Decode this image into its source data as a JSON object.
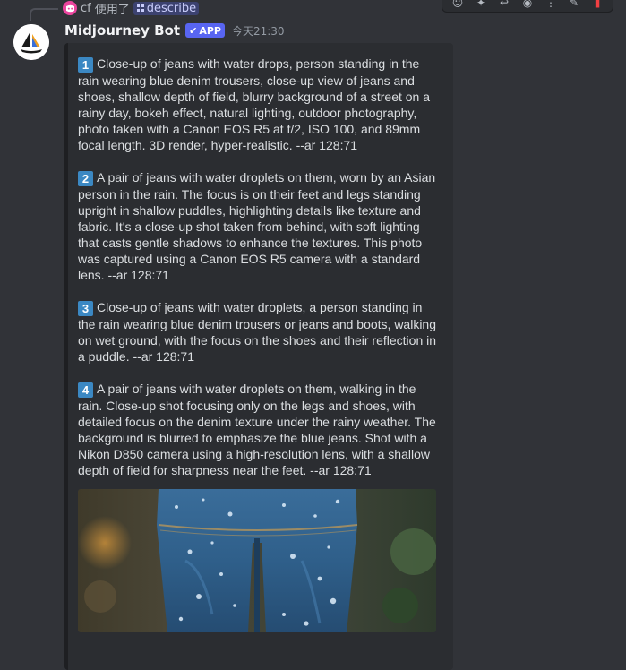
{
  "reply": {
    "user": "cf",
    "action": "使用了",
    "command": "describe"
  },
  "toolbar": {
    "icons": [
      "reaction-icon",
      "super-reaction-icon",
      "reply-icon",
      "thread-icon",
      "more-icon",
      "app-icon",
      "delete-icon"
    ]
  },
  "message": {
    "author": "Midjourney Bot",
    "badge": "APP",
    "timestamp": "今天21:30"
  },
  "embed": {
    "items": [
      {
        "number": "1",
        "text": "Close-up of jeans with water drops, person standing in the rain wearing blue denim trousers, close-up view of jeans and shoes, shallow depth of field, blurry background of a street on a rainy day, bokeh effect, natural lighting, outdoor photography, photo taken with a Canon EOS R5 at f/2, ISO 100, and 89mm focal length. 3D render, hyper-realistic. --ar 128:71"
      },
      {
        "number": "2",
        "text": "A pair of jeans with water droplets on them, worn by an Asian person in the rain. The focus is on their feet and legs standing upright in shallow puddles, highlighting details like texture and fabric. It's a close-up shot taken from behind, with soft lighting that casts gentle shadows to enhance the textures. This photo was captured using a Canon EOS R5 camera with a standard lens. --ar 128:71"
      },
      {
        "number": "3",
        "text": "Close-up of jeans with water droplets, a person standing in the rain wearing blue denim trousers or jeans and boots, walking on wet ground, with the focus on the shoes and their reflection in a puddle. --ar 128:71"
      },
      {
        "number": "4",
        "text": "A pair of jeans with water droplets on them, walking in the rain. Close-up shot focusing only on the legs and shoes, with detailed focus on the denim texture under the rainy weather. The background is blurred to emphasize the blue jeans. Shot with a Nikon D850 camera using a high-resolution lens, with a shallow depth of field for sharpness near the feet. --ar 128:71"
      }
    ]
  },
  "colors": {
    "background": "#313338",
    "embed_background": "#2b2d31",
    "app_badge": "#5865f2",
    "number_badge": "#3b88c3",
    "command_chip": "#3c4270"
  }
}
